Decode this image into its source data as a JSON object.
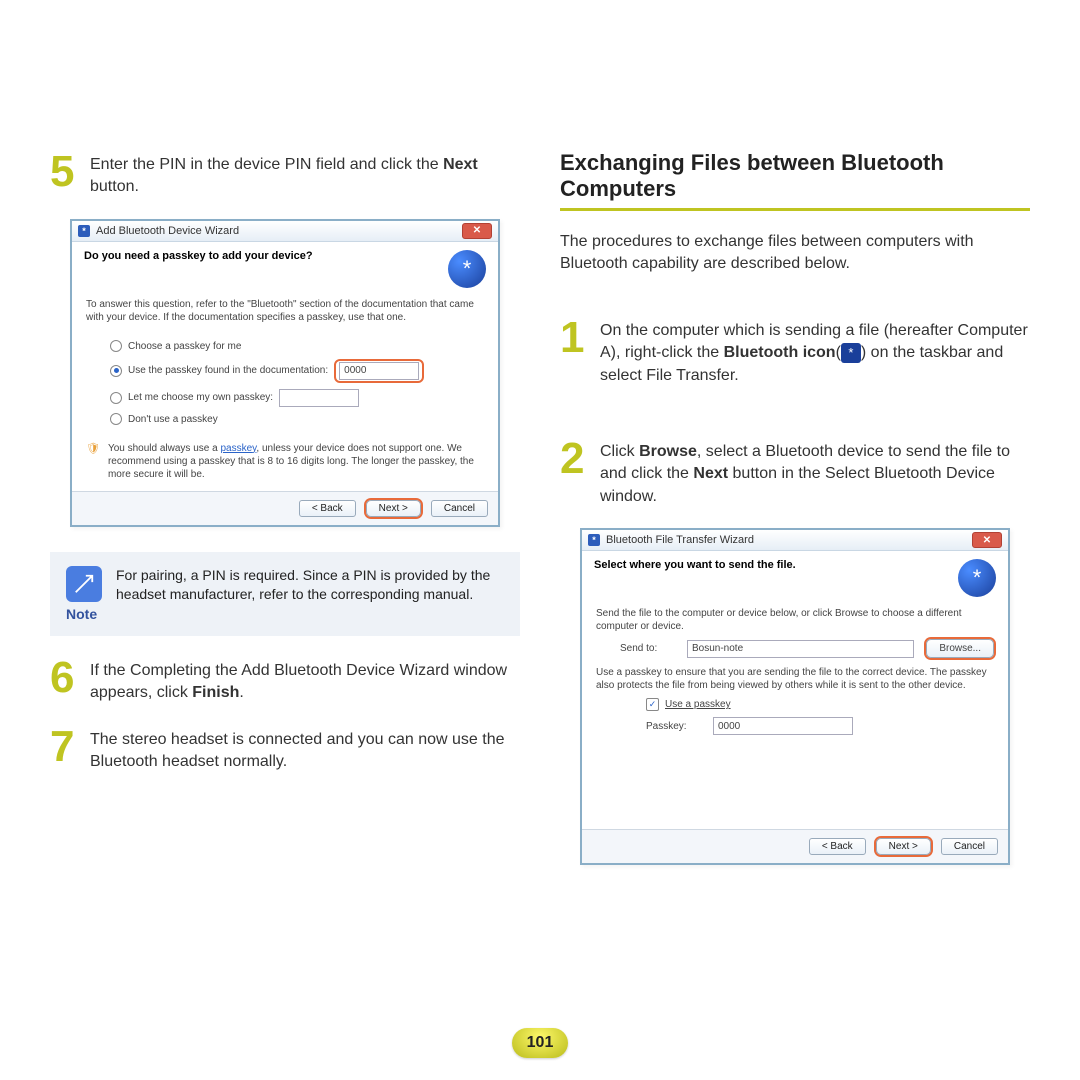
{
  "left": {
    "step5": {
      "num": "5",
      "pre": "Enter the PIN in the device PIN field and click the ",
      "bold": "Next",
      "post": " button."
    },
    "dialog1": {
      "title": "Add Bluetooth Device Wizard",
      "question": "Do you need a passkey to add your device?",
      "help": "To answer this question, refer to the \"Bluetooth\" section of the documentation that came with your device. If the documentation specifies a passkey, use that one.",
      "opt_choose": "Choose a passkey for me",
      "opt_doc": "Use the passkey found in the documentation:",
      "opt_doc_value": "0000",
      "opt_own": "Let me choose my own passkey:",
      "opt_none": "Don't use a passkey",
      "warn_pre": "You should always use a ",
      "warn_link": "passkey",
      "warn_post": ", unless your device does not support one. We recommend using a passkey that is 8 to 16 digits long. The longer the passkey, the more secure it will be.",
      "back": "< Back",
      "next": "Next >",
      "cancel": "Cancel"
    },
    "note": {
      "label": "Note",
      "text": "For pairing, a PIN is required. Since a PIN is provided by the headset manufacturer, refer to the corresponding manual."
    },
    "step6": {
      "num": "6",
      "pre": "If the Completing the Add Bluetooth Device Wizard window appears, click ",
      "bold": "Finish",
      "post": "."
    },
    "step7": {
      "num": "7",
      "text": "The stereo headset is connected and you can now use the Bluetooth headset normally."
    }
  },
  "right": {
    "heading": "Exchanging Files between Bluetooth Computers",
    "intro": "The procedures to exchange files between computers with Bluetooth capability are described below.",
    "step1": {
      "num": "1",
      "l1_pre": "On the computer which is sending a file (hereafter Computer A), right-click the ",
      "l1_bold": "Bluetooth icon",
      "l1_post1": "(",
      "l1_post2": ") on the taskbar and select File Transfer."
    },
    "step2": {
      "num": "2",
      "pre": "Click ",
      "b1": "Browse",
      "mid": ", select a Bluetooth device to send the file to and click the ",
      "b2": "Next",
      "post": " button in the Select Bluetooth Device window."
    },
    "dialog2": {
      "title": "Bluetooth File Transfer Wizard",
      "header": "Select where you want to send the file.",
      "instr1": "Send the file to the computer or device below, or click Browse to choose a different computer or device.",
      "sendto_label": "Send to:",
      "sendto_value": "Bosun-note",
      "browse": "Browse...",
      "instr2": "Use a passkey to ensure that you are sending the file to the correct device. The passkey also protects the file from being viewed by others while it is sent to the other device.",
      "use_passkey": "Use a passkey",
      "passkey_label": "Passkey:",
      "passkey_value": "0000",
      "back": "< Back",
      "next": "Next >",
      "cancel": "Cancel"
    }
  },
  "page_number": "101",
  "glyphs": {
    "bt": "*",
    "close": "✕"
  }
}
